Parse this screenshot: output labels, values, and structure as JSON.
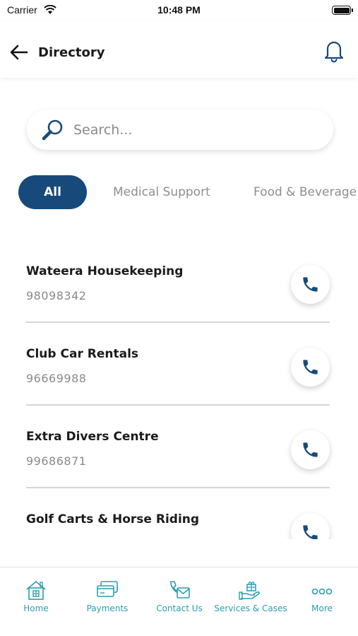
{
  "status_bar": {
    "carrier": "Carrier",
    "time": "10:48 PM"
  },
  "header": {
    "title": "Directory",
    "back_icon": "arrow-left-icon",
    "notification_icon": "bell-icon"
  },
  "search": {
    "placeholder": "Search...",
    "value": "",
    "icon": "search-icon"
  },
  "filters": {
    "selected": "All",
    "items": [
      {
        "label": "All"
      },
      {
        "label": "Medical Support"
      },
      {
        "label": "Food & Beverage"
      }
    ]
  },
  "directory": {
    "items": [
      {
        "name": "Wateera Housekeeping",
        "phone": "98098342"
      },
      {
        "name": "Club Car Rentals",
        "phone": "96669988"
      },
      {
        "name": "Extra Divers Centre",
        "phone": "99686871"
      },
      {
        "name": "Golf Carts & Horse Riding",
        "phone": ""
      }
    ]
  },
  "tab_bar": {
    "items": [
      {
        "label": "Home",
        "icon": "home-icon"
      },
      {
        "label": "Payments",
        "icon": "payments-icon"
      },
      {
        "label": "Contact Us",
        "icon": "contact-us-icon"
      },
      {
        "label": "Services & Cases",
        "icon": "services-icon"
      },
      {
        "label": "More",
        "icon": "more-icon"
      }
    ]
  },
  "colors": {
    "primary": "#174a7b",
    "tab_accent": "#2a9db0",
    "chip_inactive": "#8e8e8e"
  }
}
